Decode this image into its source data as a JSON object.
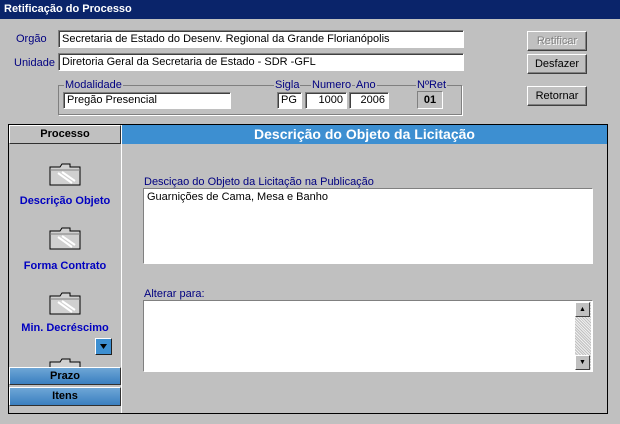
{
  "window": {
    "title": "Retificação do Processo"
  },
  "header": {
    "orgao_label": "Orgão",
    "orgao_value": "Secretaria de Estado do Desenv. Regional da Grande Florianópolis",
    "unidade_label": "Unidade",
    "unidade_value": "Diretoria Geral da Secretaria de  Estado - SDR -GFL",
    "modalidade_label": "Modalidade",
    "modalidade_value": "Pregão Presencial",
    "sigla_label": "Sigla",
    "sigla_value": "PG",
    "numero_label": "Numero",
    "numero_value": "1000",
    "ano_label": "Ano",
    "ano_value": "2006",
    "nret_label": "NºRet",
    "nret_value": "01"
  },
  "buttons": {
    "retificar": "Retificar",
    "desfazer": "Desfazer",
    "retornar": "Retornar"
  },
  "nav": {
    "section_header": "Processo",
    "items": [
      {
        "label": "Descrição Objeto",
        "icon": "folder-icon"
      },
      {
        "label": "Forma Contrato",
        "icon": "folder-icon"
      },
      {
        "label": "Min. Decréscimo",
        "icon": "folder-icon"
      }
    ],
    "footer_tabs": [
      "Prazo",
      "Itens"
    ]
  },
  "main": {
    "title": "Descrição do Objeto da Licitação",
    "current_label": "Desciçao do Objeto da Licitação na Publicação",
    "current_value": "Guarnições de Cama, Mesa e Banho",
    "change_label": "Alterar para:",
    "change_value": ""
  }
}
